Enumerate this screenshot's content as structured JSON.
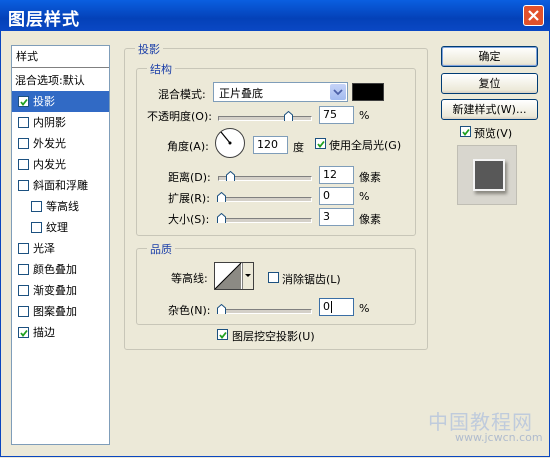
{
  "window": {
    "title": "图层样式"
  },
  "sidebar": {
    "items": [
      {
        "label": "样式",
        "type": "header",
        "checked": null
      },
      {
        "label": "混合选项:默认",
        "type": "plain",
        "checked": null
      },
      {
        "label": "投影",
        "type": "check",
        "checked": true,
        "selected": true
      },
      {
        "label": "内阴影",
        "type": "check",
        "checked": false
      },
      {
        "label": "外发光",
        "type": "check",
        "checked": false
      },
      {
        "label": "内发光",
        "type": "check",
        "checked": false
      },
      {
        "label": "斜面和浮雕",
        "type": "check",
        "checked": false
      },
      {
        "label": "等高线",
        "type": "subcheck",
        "checked": false
      },
      {
        "label": "纹理",
        "type": "subcheck",
        "checked": false
      },
      {
        "label": "光泽",
        "type": "check",
        "checked": false
      },
      {
        "label": "颜色叠加",
        "type": "check",
        "checked": false
      },
      {
        "label": "渐变叠加",
        "type": "check",
        "checked": false
      },
      {
        "label": "图案叠加",
        "type": "check",
        "checked": false
      },
      {
        "label": "描边",
        "type": "check",
        "checked": true
      }
    ]
  },
  "dropshadow": {
    "title": "投影",
    "structure": {
      "title": "结构",
      "blend_label": "混合模式:",
      "blend_value": "正片叠底",
      "blend_color": "#000000",
      "opacity_label": "不透明度(O):",
      "opacity_value": "75",
      "opacity_unit": "%",
      "angle_label": "角度(A):",
      "angle_value": "120",
      "angle_unit": "度",
      "global_light_label": "使用全局光(G)",
      "global_light_checked": true,
      "distance_label": "距离(D):",
      "distance_value": "12",
      "distance_unit": "像素",
      "spread_label": "扩展(R):",
      "spread_value": "0",
      "spread_unit": "%",
      "size_label": "大小(S):",
      "size_value": "3",
      "size_unit": "像素"
    },
    "quality": {
      "title": "品质",
      "contour_label": "等高线:",
      "antialias_label": "消除锯齿(L)",
      "antialias_checked": false,
      "noise_label": "杂色(N):",
      "noise_value": "0",
      "noise_unit": "%"
    },
    "knockout_label": "图层挖空投影(U)",
    "knockout_checked": true
  },
  "buttons": {
    "ok": "确定",
    "reset": "复位",
    "new_style": "新建样式(W)...",
    "preview_label": "预览(V)",
    "preview_checked": true
  },
  "watermark": {
    "line1": "中国教程网",
    "line2": "www.jcwcn.com"
  }
}
